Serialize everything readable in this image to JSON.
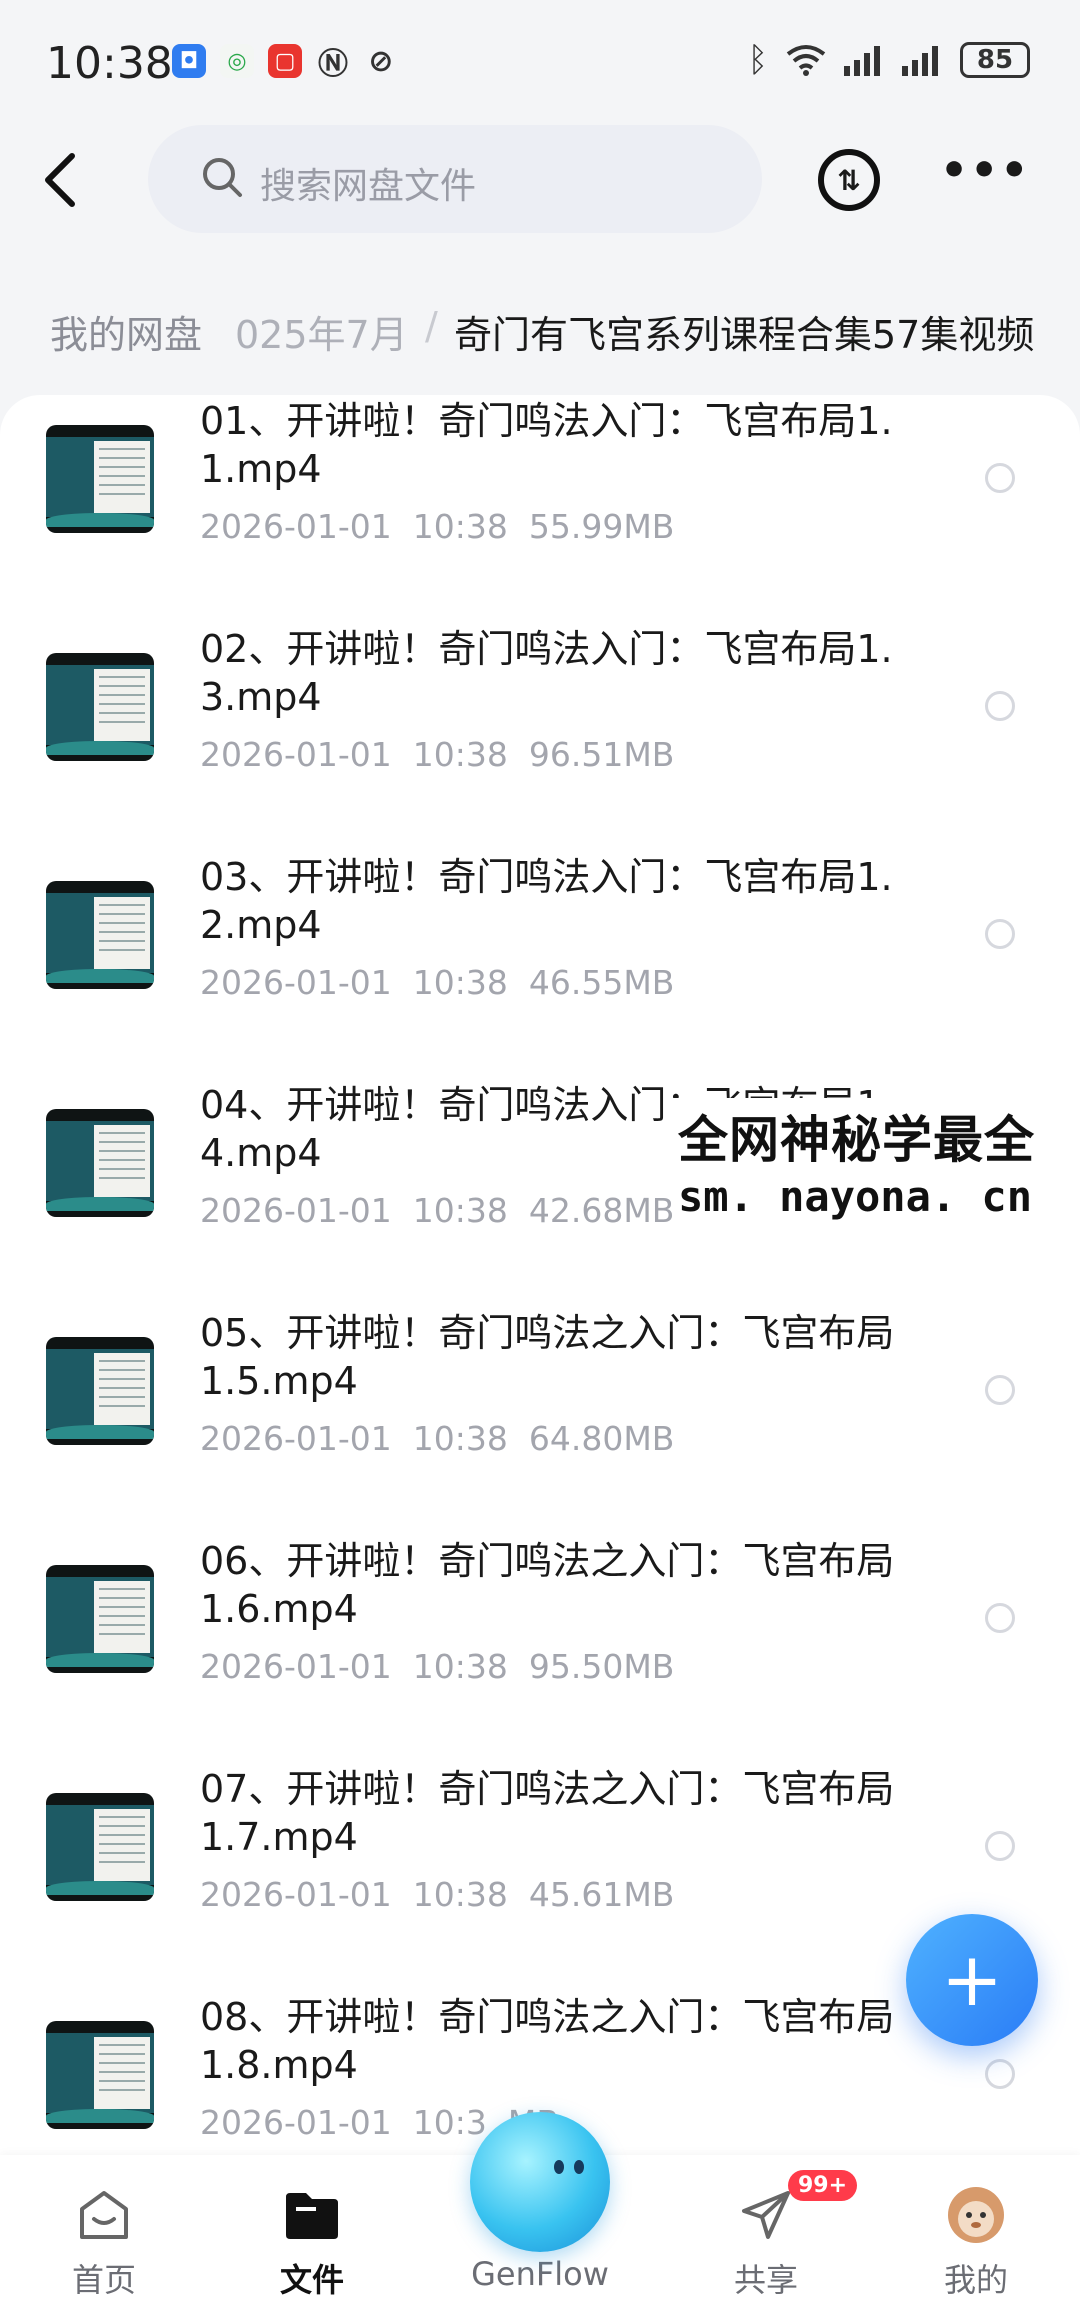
{
  "status_bar": {
    "time": "10:38",
    "battery": "85",
    "icons": [
      "app-icon-blue",
      "app-icon-green",
      "app-icon-red",
      "nfc-icon",
      "mute-icon"
    ]
  },
  "header": {
    "search_placeholder": "搜索网盘文件"
  },
  "breadcrumb": {
    "root": "我的网盘",
    "middle": "025年7月",
    "separator": "/",
    "current": "奇门有飞宫系列课程合集57集视频"
  },
  "files": [
    {
      "name": "01、开讲啦！奇门鸣法入门：飞宫布局1.1.mp4",
      "date": "2026-01-01",
      "time": "10:38",
      "size": "55.99MB"
    },
    {
      "name": "02、开讲啦！奇门鸣法入门：飞宫布局1.3.mp4",
      "date": "2026-01-01",
      "time": "10:38",
      "size": "96.51MB"
    },
    {
      "name": "03、开讲啦！奇门鸣法入门：飞宫布局1.2.mp4",
      "date": "2026-01-01",
      "time": "10:38",
      "size": "46.55MB"
    },
    {
      "name": "04、开讲啦！奇门鸣法入门：飞宫布局1.4.mp4",
      "date": "2026-01-01",
      "time": "10:38",
      "size": "42.68MB"
    },
    {
      "name": "05、开讲啦！奇门鸣法之入门：飞宫布局1.5.mp4",
      "date": "2026-01-01",
      "time": "10:38",
      "size": "64.80MB"
    },
    {
      "name": "06、开讲啦！奇门鸣法之入门：飞宫布局1.6.mp4",
      "date": "2026-01-01",
      "time": "10:38",
      "size": "95.50MB"
    },
    {
      "name": "07、开讲啦！奇门鸣法之入门：飞宫布局1.7.mp4",
      "date": "2026-01-01",
      "time": "10:38",
      "size": "45.61MB"
    },
    {
      "name": "08、开讲啦！奇门鸣法之入门：飞宫布局1.8.mp4",
      "date": "2026-01-01",
      "time": "10:3",
      "size": "MB"
    }
  ],
  "watermark": {
    "line1": "全网神秘学最全",
    "line2": "sm. nayona. cn"
  },
  "tabs": [
    {
      "label": "首页",
      "icon": "home-icon"
    },
    {
      "label": "文件",
      "icon": "folder-icon"
    },
    {
      "label": "GenFlow",
      "icon": "genflow-orb-icon"
    },
    {
      "label": "共享",
      "icon": "share-plane-icon"
    },
    {
      "label": "我的",
      "icon": "avatar-icon"
    }
  ],
  "share_badge": "99+",
  "colors": {
    "accent": "#2a7cf6",
    "badge": "#ff3b4a"
  }
}
